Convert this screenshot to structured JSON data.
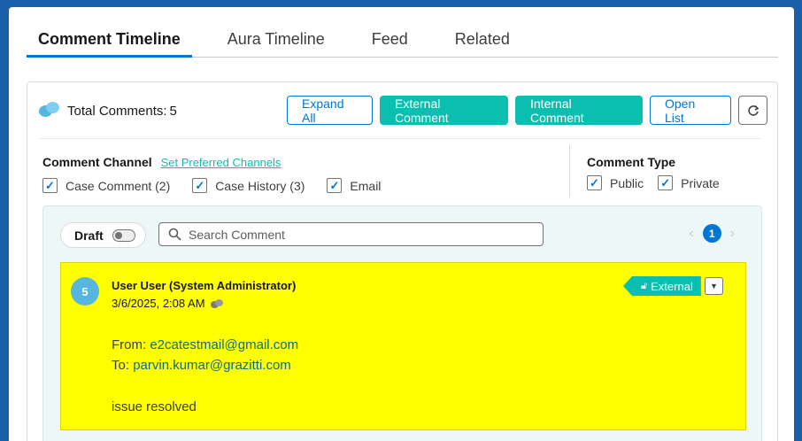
{
  "tabs": [
    {
      "label": "Comment Timeline",
      "active": true
    },
    {
      "label": "Aura Timeline"
    },
    {
      "label": "Feed"
    },
    {
      "label": "Related"
    }
  ],
  "summary": {
    "total_label": "Total Comments:",
    "total_count": "5"
  },
  "actions": {
    "expand_all": "Expand All",
    "external_comment": "External Comment",
    "internal_comment": "Internal Comment",
    "open_list": "Open List",
    "refresh_icon": "refresh-icon"
  },
  "filters": {
    "channel_label": "Comment Channel",
    "set_preferred": "Set Preferred Channels",
    "channels": [
      {
        "label": "Case Comment (2)",
        "checked": true
      },
      {
        "label": "Case History (3)",
        "checked": true
      },
      {
        "label": "Email",
        "checked": true
      }
    ],
    "type_label": "Comment Type",
    "types": [
      {
        "label": "Public",
        "checked": true
      },
      {
        "label": "Private",
        "checked": true
      }
    ]
  },
  "toolbar": {
    "draft_label": "Draft",
    "search_placeholder": "Search Comment",
    "current_page": "1"
  },
  "comment": {
    "number": "5",
    "author": "User User (System Administrator)",
    "datetime": "3/6/2025, 2:08 AM",
    "badge": "External",
    "from_label": "From:",
    "from_email": "e2catestmail@gmail.com",
    "to_label": "To:",
    "to_email": "parvin.kumar@grazitti.com",
    "text": "issue resolved",
    "highlight_color": "#ffff00"
  },
  "colors": {
    "accent": "#0176d3",
    "teal": "#0bbfb0"
  }
}
